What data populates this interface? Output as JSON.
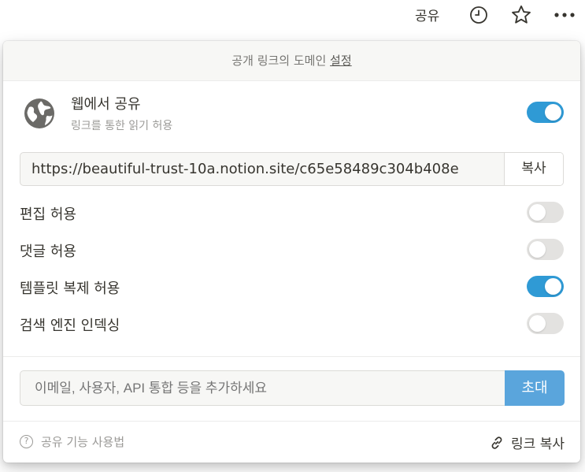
{
  "topbar": {
    "share_label": "공유",
    "clock_icon": "clock-icon",
    "star_icon": "star-icon",
    "more_icon": "more-icon"
  },
  "panel": {
    "domain_text": "공개 링크의 도메인 ",
    "domain_link": "설정",
    "web_share": {
      "title": "웹에서 공유",
      "subtitle": "링크를 통한 읽기 허용",
      "enabled": true,
      "icon": "globe-icon"
    },
    "url": "https://beautiful-trust-10a.notion.site/c65e58489c304b408e",
    "copy_label": "복사",
    "options": [
      {
        "label": "편집 허용",
        "enabled": false
      },
      {
        "label": "댓글 허용",
        "enabled": false
      },
      {
        "label": "템플릿 복제 허용",
        "enabled": true
      },
      {
        "label": "검색 엔진 인덱싱",
        "enabled": false
      }
    ],
    "invite": {
      "placeholder": "이메일, 사용자, API 통합 등을 추가하세요",
      "button_label": "초대"
    },
    "footer": {
      "help_label": "공유 기능 사용법",
      "copy_link_label": "링크 복사",
      "help_icon": "question-icon",
      "link_icon": "link-icon"
    }
  },
  "colors": {
    "toggle_on": "#2f9ad5",
    "toggle_off": "#e3e2e0",
    "invite_button": "#5aa5dc"
  }
}
